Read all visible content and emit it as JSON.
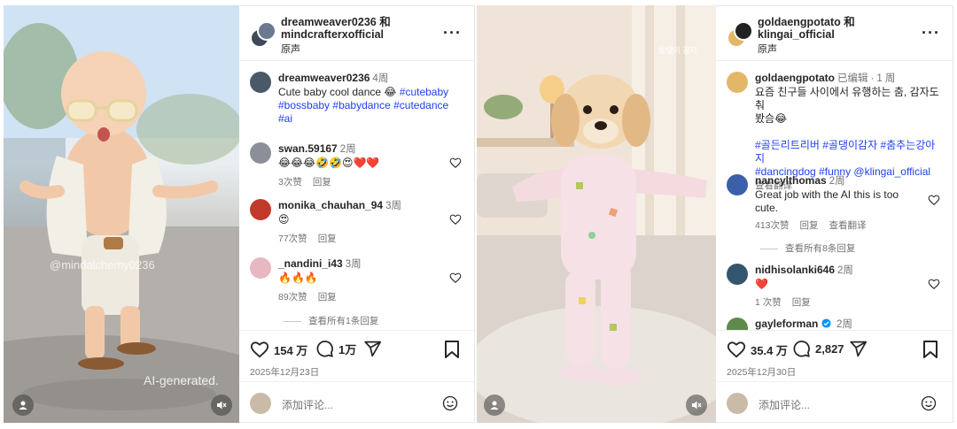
{
  "post1": {
    "header": {
      "title_line1": "dreamweaver0236 和",
      "title_line2": "mindcrafterxofficial",
      "audio": "原声"
    },
    "media": {
      "watermark_user": "@mindalchemy0236",
      "ai_label": "AI-generated."
    },
    "caption": {
      "user": "dreamweaver0236",
      "time": "4周",
      "text": "Cute baby cool dance 😂",
      "tags": [
        "#cutebaby",
        "#bossbaby",
        "#babydance",
        "#cutedance",
        "#ai"
      ]
    },
    "comments": [
      {
        "user": "swan.59167",
        "time": "2周",
        "text": "😂😂😂🤣🤣😍❤️❤️",
        "likes": "3次赞",
        "reply": "回复"
      },
      {
        "user": "monika_chauhan_94",
        "time": "3周",
        "text": "😍",
        "likes": "77次赞",
        "reply": "回复"
      },
      {
        "user": "_nandini_i43",
        "time": "3周",
        "text": "🔥🔥🔥",
        "likes": "89次赞",
        "reply": "回复"
      }
    ],
    "view_replies": "查看所有1条回复",
    "likes": "154 万",
    "comment_count": "1万",
    "date": "2025年12月23日",
    "add_comment_placeholder": "添加评论..."
  },
  "post2": {
    "header": {
      "title_line1": "goldaengpotato 和",
      "title_line2": "klingai_official",
      "audio": "原声"
    },
    "media": {
      "watermark_text": "등탱이 감자"
    },
    "caption": {
      "user": "goldaengpotato",
      "edited": "已编辑",
      "time": "1 周",
      "text_line1": "요즘 친구들 사이에서 유행하는 춤, 감자도 춰",
      "text_line2": "봤슴😂",
      "tags_line1": "#골든리트리버 #골댕이감자 #춤추는강아지",
      "tags_line2": "#dancingdog #funny @klingai_official",
      "see_translation": "查看翻译"
    },
    "comments": [
      {
        "user": "nancylthomas",
        "time": "2周",
        "text": "Great job with the AI this is too cute.",
        "likes": "413次赞",
        "reply": "回复",
        "translate": "查看翻译"
      },
      {
        "user": "nidhisolanki646",
        "time": "2周",
        "text": "❤️",
        "likes": "1 次赞",
        "reply": "回复"
      },
      {
        "user": "gayleforman",
        "time": "2周",
        "text": ""
      }
    ],
    "view_replies": "查看所有8条回复",
    "likes": "35.4 万",
    "comment_count": "2,827",
    "date": "2025年12月30日",
    "add_comment_placeholder": "添加评论..."
  },
  "colors": {
    "hashtag": "#1f3ff5",
    "muted": "#737373",
    "verified": "#0095f6"
  }
}
